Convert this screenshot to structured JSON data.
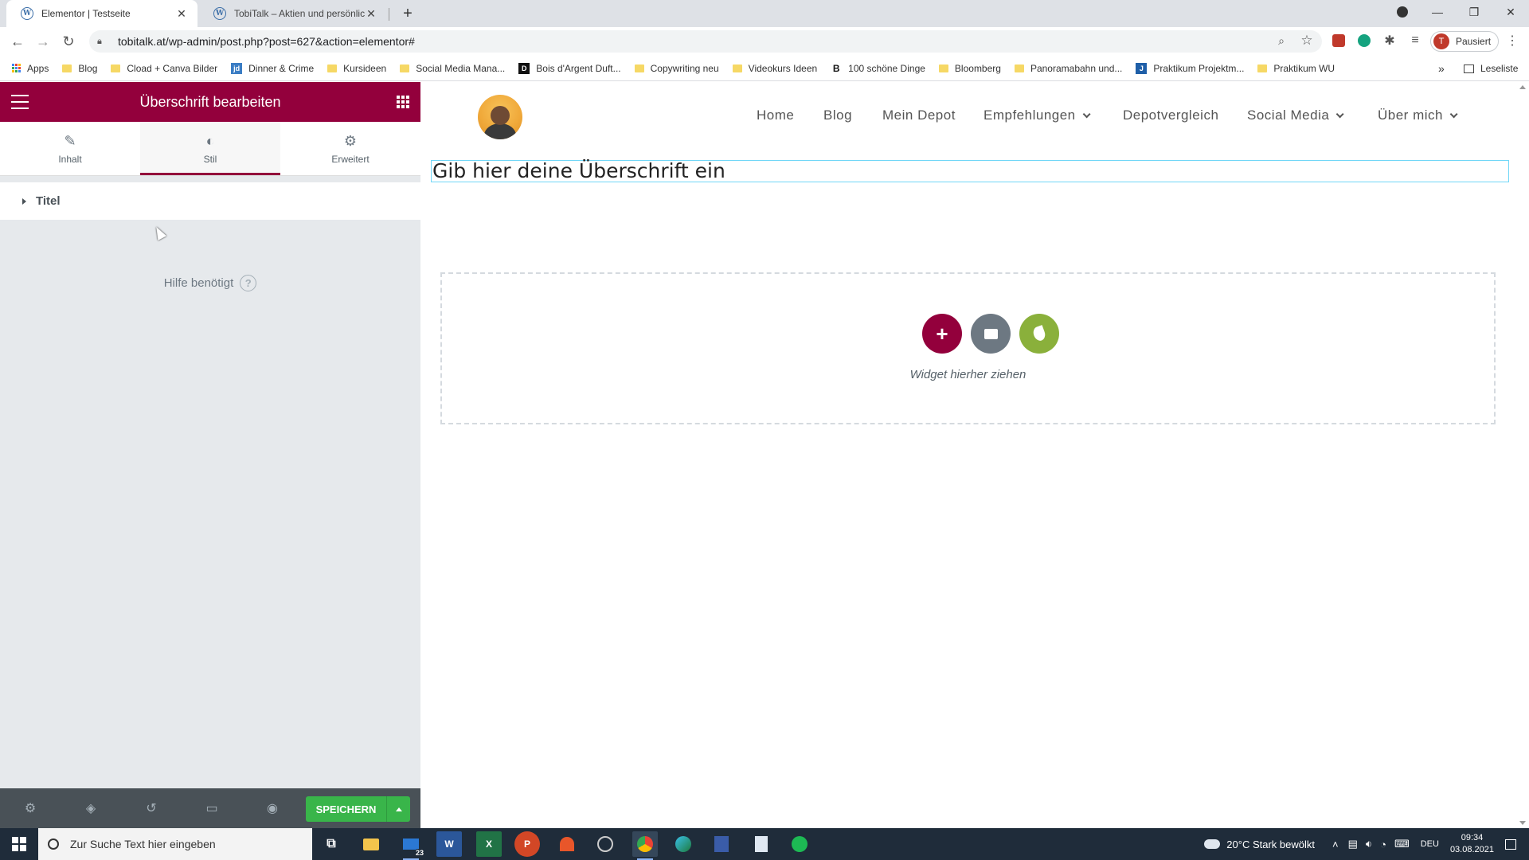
{
  "browser": {
    "tabs": [
      {
        "title": "Elementor | Testseite",
        "active": true
      },
      {
        "title": "TobiTalk – Aktien und persönliche",
        "active": false
      }
    ],
    "url": "tobitalk.at/wp-admin/post.php?post=627&action=elementor#",
    "profile_label": "Pausiert",
    "profile_initial": "T",
    "bookmarks": [
      {
        "label": "Apps",
        "icon": "apps-grid-icon"
      },
      {
        "label": "Blog",
        "icon": "folder-icon"
      },
      {
        "label": "Cload + Canva Bilder",
        "icon": "folder-icon"
      },
      {
        "label": "Dinner & Crime",
        "icon": "jd-icon"
      },
      {
        "label": "Kursideen",
        "icon": "folder-icon"
      },
      {
        "label": "Social Media Mana...",
        "icon": "folder-icon"
      },
      {
        "label": "Bois d'Argent Duft...",
        "icon": "dior-icon"
      },
      {
        "label": "Copywriting neu",
        "icon": "folder-icon"
      },
      {
        "label": "Videokurs Ideen",
        "icon": "folder-icon"
      },
      {
        "label": "100 schöne Dinge",
        "icon": "b-icon"
      },
      {
        "label": "Bloomberg",
        "icon": "folder-icon"
      },
      {
        "label": "Panoramabahn und...",
        "icon": "folder-icon"
      },
      {
        "label": "Praktikum Projektm...",
        "icon": "j-icon"
      },
      {
        "label": "Praktikum WU",
        "icon": "folder-icon"
      }
    ],
    "more_bookmarks": "»",
    "reading_list": "Leseliste"
  },
  "panel": {
    "title": "Überschrift bearbeiten",
    "tabs": [
      {
        "label": "Inhalt",
        "icon": "pencil-icon"
      },
      {
        "label": "Stil",
        "icon": "contrast-icon",
        "active": true
      },
      {
        "label": "Erweitert",
        "icon": "gear-icon"
      }
    ],
    "section_title": "Titel",
    "help_label": "Hilfe benötigt",
    "help_glyph": "?",
    "save_label": "SPEICHERN"
  },
  "site": {
    "nav": [
      {
        "label": "Home",
        "dropdown": false
      },
      {
        "label": "Blog",
        "dropdown": false
      },
      {
        "label": "Mein Depot",
        "dropdown": false
      },
      {
        "label": "Empfehlungen",
        "dropdown": true
      },
      {
        "label": "Depotvergleich",
        "dropdown": false
      },
      {
        "label": "Social Media",
        "dropdown": true
      },
      {
        "label": "Über mich",
        "dropdown": true
      }
    ],
    "heading": "Gib hier deine Überschrift ein",
    "dropzone_label": "Widget hierher ziehen"
  },
  "taskbar": {
    "search_placeholder": "Zur Suche Text hier eingeben",
    "mail_badge": "23",
    "weather": "20°C  Stark bewölkt",
    "language": "DEU",
    "time": "09:34",
    "date": "03.08.2021"
  },
  "colors": {
    "elementor_primary": "#93003c",
    "save_green": "#39b54a",
    "kit_green": "#8ab03b",
    "heading_outline": "#71d7f7"
  }
}
